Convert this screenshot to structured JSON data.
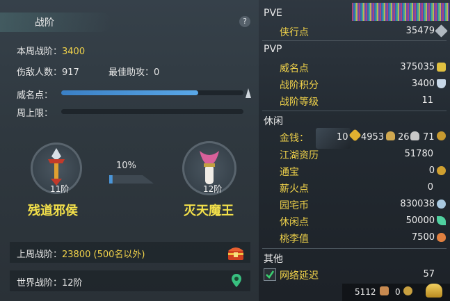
{
  "left": {
    "title": "战阶",
    "help": "?",
    "weekly_label": "本周战阶：",
    "weekly_value": "3400",
    "kills_label": "伤敌人数：",
    "kills_value": "917",
    "assist_label": "最佳助攻：",
    "assist_value": "0",
    "prestige_label": "威名点：",
    "prestige_fill": 0.75,
    "weekly_cap_label": "周上限：",
    "weekly_cap_fill": 0.0,
    "current_rank": {
      "tier": "11阶",
      "name": "残道邪侯"
    },
    "next_rank": {
      "tier": "12阶",
      "name": "灭天魔王"
    },
    "progress_text": "10%",
    "progress": 0.1,
    "last_week_label": "上周战阶：",
    "last_week_value": "23800 (500名以外)",
    "world_label": "世界战阶：",
    "world_value": "12阶"
  },
  "right": {
    "sec_pve": "PVE",
    "pve": [
      {
        "label": "侠行点",
        "value": "35479",
        "icon": "sword-icon"
      }
    ],
    "sec_pvp": "PVP",
    "pvp": [
      {
        "label": "威名点",
        "value": "375035",
        "icon": "medal-icon"
      },
      {
        "label": "战阶积分",
        "value": "3400",
        "icon": "crest-icon"
      },
      {
        "label": "战阶等级",
        "value": "11"
      }
    ],
    "sec_leisure": "休闲",
    "money_label": "金钱：",
    "money_gold": "10",
    "money_silver": "4953",
    "money_copper": "26",
    "money_wen": "71",
    "leisure": [
      {
        "label": "江湖资历",
        "value": "51780"
      },
      {
        "label": "通宝",
        "value": "0",
        "icon": "coin-icon"
      },
      {
        "label": "薪火点",
        "value": "0"
      },
      {
        "label": "园宅币",
        "value": "830038",
        "icon": "swirl-icon"
      },
      {
        "label": "休闲点",
        "value": "50000",
        "icon": "leaf-icon"
      },
      {
        "label": "桃李值",
        "value": "7500",
        "icon": "gourd-icon"
      }
    ],
    "sec_other": "其他",
    "latency_label": "网络延迟",
    "latency_value": "57",
    "footer_value1": "5112",
    "footer_value2": "0"
  },
  "colors": {
    "gold_text": "#f0d24a",
    "bar_blue": "#4a95d8"
  }
}
